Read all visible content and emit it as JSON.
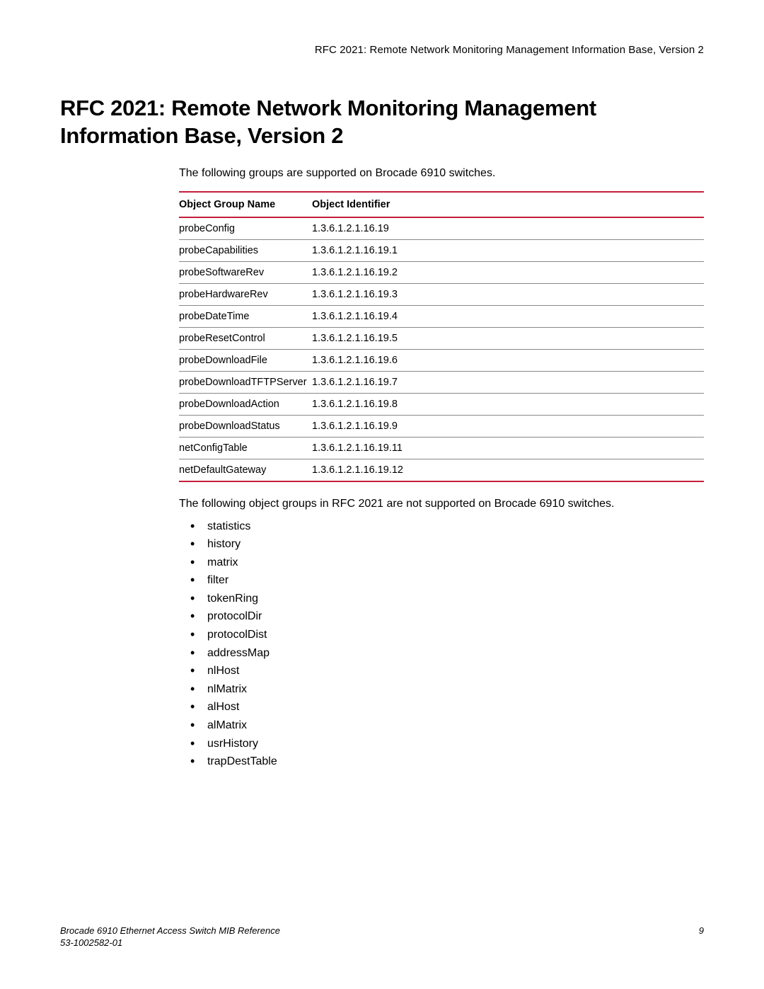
{
  "running_header": "RFC 2021: Remote Network Monitoring Management Information Base, Version 2",
  "title": "RFC 2021: Remote Network Monitoring Management Information Base, Version 2",
  "intro": "The following groups are supported on Brocade 6910 switches.",
  "table": {
    "headers": {
      "name": "Object Group Name",
      "oid": "Object Identifier"
    },
    "rows": [
      {
        "name": "probeConfig",
        "oid": "1.3.6.1.2.1.16.19"
      },
      {
        "name": "probeCapabilities",
        "oid": "1.3.6.1.2.1.16.19.1"
      },
      {
        "name": "probeSoftwareRev",
        "oid": "1.3.6.1.2.1.16.19.2"
      },
      {
        "name": "probeHardwareRev",
        "oid": "1.3.6.1.2.1.16.19.3"
      },
      {
        "name": "probeDateTime",
        "oid": "1.3.6.1.2.1.16.19.4"
      },
      {
        "name": "probeResetControl",
        "oid": "1.3.6.1.2.1.16.19.5"
      },
      {
        "name": "probeDownloadFile",
        "oid": "1.3.6.1.2.1.16.19.6"
      },
      {
        "name": "probeDownloadTFTPServer",
        "oid": "1.3.6.1.2.1.16.19.7"
      },
      {
        "name": "probeDownloadAction",
        "oid": "1.3.6.1.2.1.16.19.8"
      },
      {
        "name": "probeDownloadStatus",
        "oid": "1.3.6.1.2.1.16.19.9"
      },
      {
        "name": "netConfigTable",
        "oid": "1.3.6.1.2.1.16.19.11"
      },
      {
        "name": "netDefaultGateway",
        "oid": "1.3.6.1.2.1.16.19.12"
      }
    ]
  },
  "unsupported_intro": "The following object groups in RFC 2021 are not supported on Brocade 6910 switches.",
  "unsupported_list": [
    "statistics",
    "history",
    "matrix",
    "filter",
    "tokenRing",
    "protocolDir",
    "protocolDist",
    "addressMap",
    "nlHost",
    "nlMatrix",
    "alHost",
    "alMatrix",
    "usrHistory",
    "trapDestTable"
  ],
  "footer": {
    "line1": "Brocade 6910 Ethernet Access Switch MIB Reference",
    "line2": "53-1002582-01",
    "page": "9"
  }
}
